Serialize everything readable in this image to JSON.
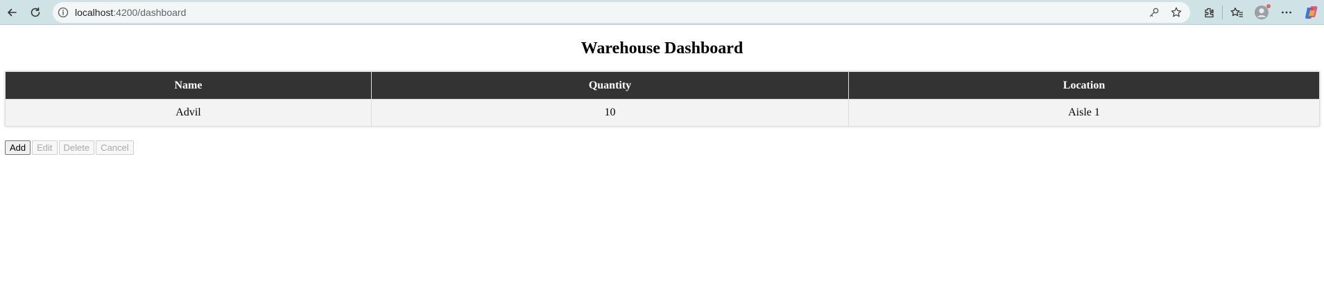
{
  "browser": {
    "url_host": "localhost",
    "url_path": ":4200/dashboard",
    "icons": [
      "back-icon",
      "reload-icon",
      "site-info-icon",
      "password-key-icon",
      "favorite-star-icon",
      "extensions-icon",
      "favorites-icon",
      "profile-icon",
      "more-icon",
      "copilot-icon"
    ]
  },
  "page": {
    "title": "Warehouse Dashboard"
  },
  "table": {
    "headers": {
      "name": "Name",
      "quantity": "Quantity",
      "location": "Location"
    },
    "rows": [
      {
        "name": "Advil",
        "quantity": "10",
        "location": "Aisle 1"
      }
    ]
  },
  "actions": {
    "add": "Add",
    "edit": "Edit",
    "delete": "Delete",
    "cancel": "Cancel",
    "enabled": {
      "add": true,
      "edit": false,
      "delete": false,
      "cancel": false
    }
  },
  "colors": {
    "toolbar_bg": "#cfe2e5",
    "header_bg": "#333333",
    "row_bg": "#f3f3f3"
  }
}
